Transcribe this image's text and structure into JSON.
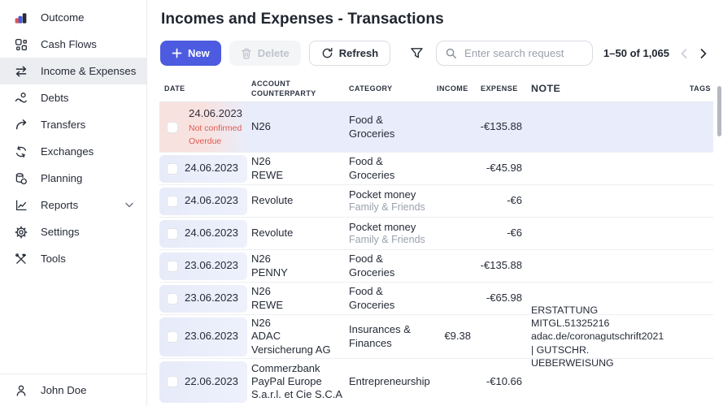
{
  "sidebar": {
    "items": [
      {
        "label": "Outcome"
      },
      {
        "label": "Cash Flows"
      },
      {
        "label": "Income & Expenses"
      },
      {
        "label": "Debts"
      },
      {
        "label": "Transfers"
      },
      {
        "label": "Exchanges"
      },
      {
        "label": "Planning"
      },
      {
        "label": "Reports"
      },
      {
        "label": "Settings"
      },
      {
        "label": "Tools"
      }
    ],
    "user": "John Doe"
  },
  "header": {
    "title": "Incomes and Expenses - Transactions"
  },
  "toolbar": {
    "new_label": "New",
    "delete_label": "Delete",
    "refresh_label": "Refresh"
  },
  "search": {
    "placeholder": "Enter search request"
  },
  "pagination": {
    "range": "1–50 of 1,065"
  },
  "table": {
    "headers": {
      "date": "DATE",
      "account": "ACCOUNT",
      "counterparty": "COUNTERPARTY",
      "category": "CATEGORY",
      "income": "INCOME",
      "expense": "EXPENSE",
      "note": "NOTE",
      "tags": "TAGS"
    },
    "rows": [
      {
        "date": "24.06.2023",
        "status_labels": [
          "Not confirmed",
          "Overdue"
        ],
        "account": "N26",
        "counterparty": "",
        "category": "Food & Groceries",
        "subcategory": "",
        "income": "",
        "expense": "-€135.88",
        "note": "",
        "tags": ""
      },
      {
        "date": "24.06.2023",
        "account": "N26",
        "counterparty": "REWE",
        "category": "Food & Groceries",
        "subcategory": "",
        "income": "",
        "expense": "-€45.98",
        "note": "",
        "tags": ""
      },
      {
        "date": "24.06.2023",
        "account": "Revolute",
        "counterparty": "",
        "category": "Pocket money",
        "subcategory": "Family & Friends",
        "income": "",
        "expense": "-€6",
        "note": "",
        "tags": ""
      },
      {
        "date": "24.06.2023",
        "account": "Revolute",
        "counterparty": "",
        "category": "Pocket money",
        "subcategory": "Family & Friends",
        "income": "",
        "expense": "-€6",
        "note": "",
        "tags": ""
      },
      {
        "date": "23.06.2023",
        "account": "N26",
        "counterparty": "PENNY",
        "category": "Food & Groceries",
        "subcategory": "",
        "income": "",
        "expense": "-€135.88",
        "note": "",
        "tags": ""
      },
      {
        "date": "23.06.2023",
        "account": "N26",
        "counterparty": "REWE",
        "category": "Food & Groceries",
        "subcategory": "",
        "income": "",
        "expense": "-€65.98",
        "note": "",
        "tags": ""
      },
      {
        "date": "23.06.2023",
        "account": "N26",
        "counterparty": "ADAC Versicherung AG",
        "category": "Insurances & Finances",
        "subcategory": "",
        "income": "€9.38",
        "expense": "",
        "note": "ERSTATTUNG MITGL.51325216 adac.de/coronagutschrift2021 | GUTSCHR. UEBERWEISUNG",
        "tags": ""
      },
      {
        "date": "22.06.2023",
        "account": "Commerzbank",
        "counterparty": "PayPal Europe S.a.r.l. et Cie S.C.A",
        "category": "Entrepreneurship",
        "subcategory": "",
        "income": "",
        "expense": "-€10.66",
        "note": "",
        "tags": ""
      }
    ]
  },
  "colors": {
    "accent": "#4c5be0",
    "danger": "#df5a50",
    "selected_row": "#e9edfb",
    "date_cell": "#e8ecfa",
    "overdue_cell": "#f8e2e0"
  }
}
